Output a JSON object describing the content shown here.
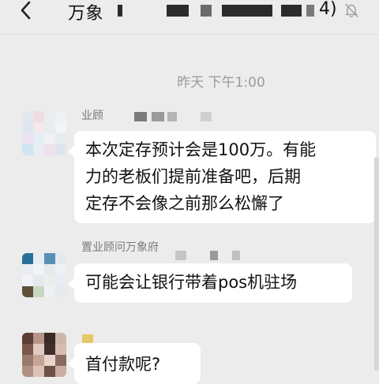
{
  "header": {
    "back_icon": "chevron-left-icon",
    "title_prefix": "万象",
    "title_suffix": "4)",
    "mute_icon": "bell-slash-icon"
  },
  "timestamp": "昨天 下午1:00",
  "messages": [
    {
      "sender": "业顾",
      "lines": [
        "本次定存预计会是100万。有能",
        "力的老板们提前准备吧，后期",
        "定存不会像之前那么松懈了"
      ]
    },
    {
      "sender": "置业顾问万象府",
      "lines": [
        "可能会让银行带着pos机驻场"
      ]
    },
    {
      "sender": "",
      "lines": [
        "首付款呢?"
      ]
    }
  ],
  "colors": {
    "background": "#ececec",
    "bubble": "#ffffff",
    "text": "#111111",
    "meta_text": "#9a9a9a"
  }
}
